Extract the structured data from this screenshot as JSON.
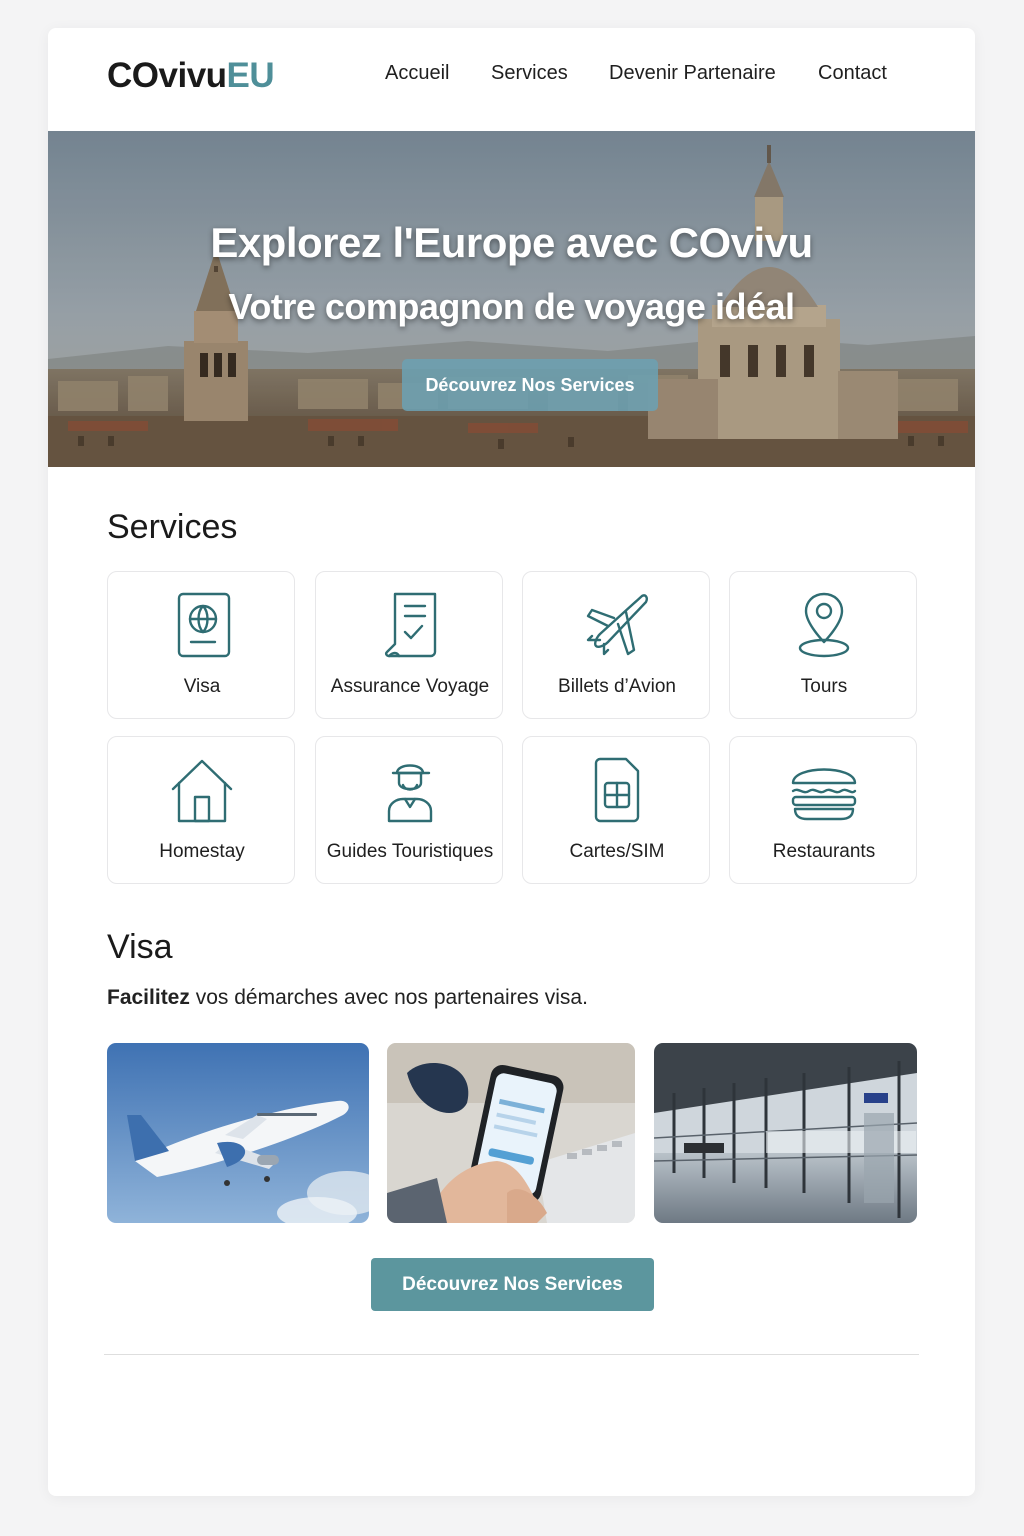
{
  "header": {
    "logo_main": "COvivu",
    "logo_accent": "EU",
    "nav": [
      "Accueil",
      "Services",
      "Devenir Partenaire",
      "Contact"
    ]
  },
  "hero": {
    "title": "Explorez l'Europe avec COvivu",
    "subtitle": "Votre compagnon de voyage idéal",
    "button": "Découvrez Nos Services"
  },
  "services": {
    "title": "Services",
    "items": [
      {
        "label": "Visa",
        "icon": "passport-icon"
      },
      {
        "label": "Assurance Voyage",
        "icon": "insurance-document-icon"
      },
      {
        "label": "Billets d’Avion",
        "icon": "airplane-icon"
      },
      {
        "label": "Tours",
        "icon": "map-pin-icon"
      },
      {
        "label": "Homestay",
        "icon": "house-icon"
      },
      {
        "label": "Guides Touristiques",
        "icon": "tour-guide-icon"
      },
      {
        "label": "Cartes/SIM",
        "icon": "sim-card-icon"
      },
      {
        "label": "Restaurants",
        "icon": "burger-icon"
      }
    ]
  },
  "visa": {
    "title": "Visa",
    "desc_bold": "Facilitez",
    "desc_rest": " vos démarches avec nos partenaires visa.",
    "button": "Découvrez Nos Services"
  },
  "colors": {
    "accent": "#4f8f99",
    "button": "#5c969e",
    "icon_stroke": "#2f6d73"
  }
}
